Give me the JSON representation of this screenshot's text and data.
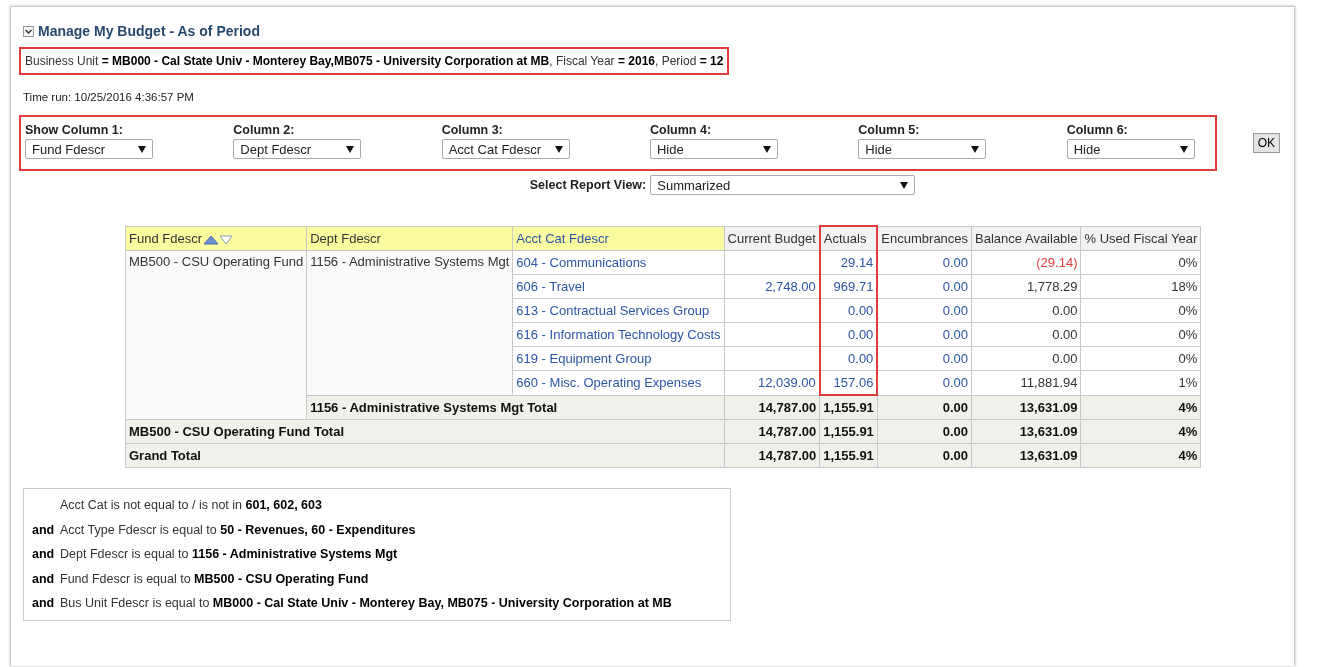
{
  "panel": {
    "title": "Manage My Budget - As of Period",
    "expanded": true
  },
  "prompt_summary": "Business Unit **= MB000 - Cal State Univ - Monterey Bay,MB075 - University Corporation at MB**, Fiscal Year **= 2016**, Period **= 12**",
  "time_run": "Time run: 10/25/2016 4:36:57 PM",
  "column_selectors": [
    {
      "label": "Show Column 1:",
      "value": "Fund Fdescr"
    },
    {
      "label": "Column 2:",
      "value": "Dept Fdescr"
    },
    {
      "label": "Column 3:",
      "value": "Acct Cat Fdescr"
    },
    {
      "label": "Column 4:",
      "value": "Hide"
    },
    {
      "label": "Column 5:",
      "value": "Hide"
    },
    {
      "label": "Column 6:",
      "value": "Hide"
    }
  ],
  "ok_button": "OK",
  "report_view": {
    "label": "Select Report View:",
    "value": "Summarized"
  },
  "table": {
    "columns": [
      {
        "label": "Fund Fdescr",
        "kind": "dimension",
        "sortable": true,
        "highlighted": false
      },
      {
        "label": "Dept Fdescr",
        "kind": "dimension",
        "sortable": false,
        "highlighted": false
      },
      {
        "label": "Acct Cat Fdescr",
        "kind": "link",
        "sortable": false,
        "highlighted": false
      },
      {
        "label": "Current Budget",
        "kind": "measure",
        "sortable": false,
        "highlighted": false
      },
      {
        "label": "Actuals",
        "kind": "measure",
        "sortable": false,
        "highlighted": true
      },
      {
        "label": "Encumbrances",
        "kind": "measure",
        "sortable": false,
        "highlighted": false
      },
      {
        "label": "Balance Available",
        "kind": "measure",
        "sortable": false,
        "highlighted": false
      },
      {
        "label": "% Used Fiscal Year",
        "kind": "measure",
        "sortable": false,
        "highlighted": false
      }
    ],
    "fund": "MB500 - CSU Operating Fund",
    "dept": "1156 - Administrative Systems Mgt",
    "rows": [
      {
        "acct_cat": "604 - Communications",
        "current_budget": "",
        "actuals": "29.14",
        "encumbrances": "0.00",
        "balance_available": "(29.14)",
        "negative": true,
        "pct_used": "0%"
      },
      {
        "acct_cat": "606 - Travel",
        "current_budget": "2,748.00",
        "actuals": "969.71",
        "encumbrances": "0.00",
        "balance_available": "1,778.29",
        "negative": false,
        "pct_used": "18%"
      },
      {
        "acct_cat": "613 - Contractual Services Group",
        "current_budget": "",
        "actuals": "0.00",
        "encumbrances": "0.00",
        "balance_available": "0.00",
        "negative": false,
        "pct_used": "0%"
      },
      {
        "acct_cat": "616 - Information Technology Costs",
        "current_budget": "",
        "actuals": "0.00",
        "encumbrances": "0.00",
        "balance_available": "0.00",
        "negative": false,
        "pct_used": "0%"
      },
      {
        "acct_cat": "619 - Equipment Group",
        "current_budget": "",
        "actuals": "0.00",
        "encumbrances": "0.00",
        "balance_available": "0.00",
        "negative": false,
        "pct_used": "0%"
      },
      {
        "acct_cat": "660 - Misc. Operating Expenses",
        "current_budget": "12,039.00",
        "actuals": "157.06",
        "encumbrances": "0.00",
        "balance_available": "11,881.94",
        "negative": false,
        "pct_used": "1%"
      }
    ],
    "totals": [
      {
        "label": "1156 - Administrative Systems Mgt Total",
        "current_budget": "14,787.00",
        "actuals": "1,155.91",
        "encumbrances": "0.00",
        "balance_available": "13,631.09",
        "pct_used": "4%"
      },
      {
        "label": "MB500 - CSU Operating Fund Total",
        "current_budget": "14,787.00",
        "actuals": "1,155.91",
        "encumbrances": "0.00",
        "balance_available": "13,631.09",
        "pct_used": "4%"
      },
      {
        "label": "Grand Total",
        "current_budget": "14,787.00",
        "actuals": "1,155.91",
        "encumbrances": "0.00",
        "balance_available": "13,631.09",
        "pct_used": "4%"
      }
    ]
  },
  "filters": [
    {
      "text": "Acct Cat is not equal to / is not in **601, 602, 603**"
    },
    {
      "conjunction": "and",
      "text": "Acct Type Fdescr is equal to **50 - Revenues, 60 - Expenditures**"
    },
    {
      "conjunction": "and",
      "text": "Dept Fdescr is equal to **1156 - Administrative Systems Mgt**"
    },
    {
      "conjunction": "and",
      "text": "Fund Fdescr is equal to **MB500 - CSU Operating Fund**"
    },
    {
      "conjunction": "and",
      "text": "Bus Unit Fdescr is equal to **MB000 - Cal State Univ - Monterey Bay, MB075 - University Corporation at MB**"
    }
  ]
}
